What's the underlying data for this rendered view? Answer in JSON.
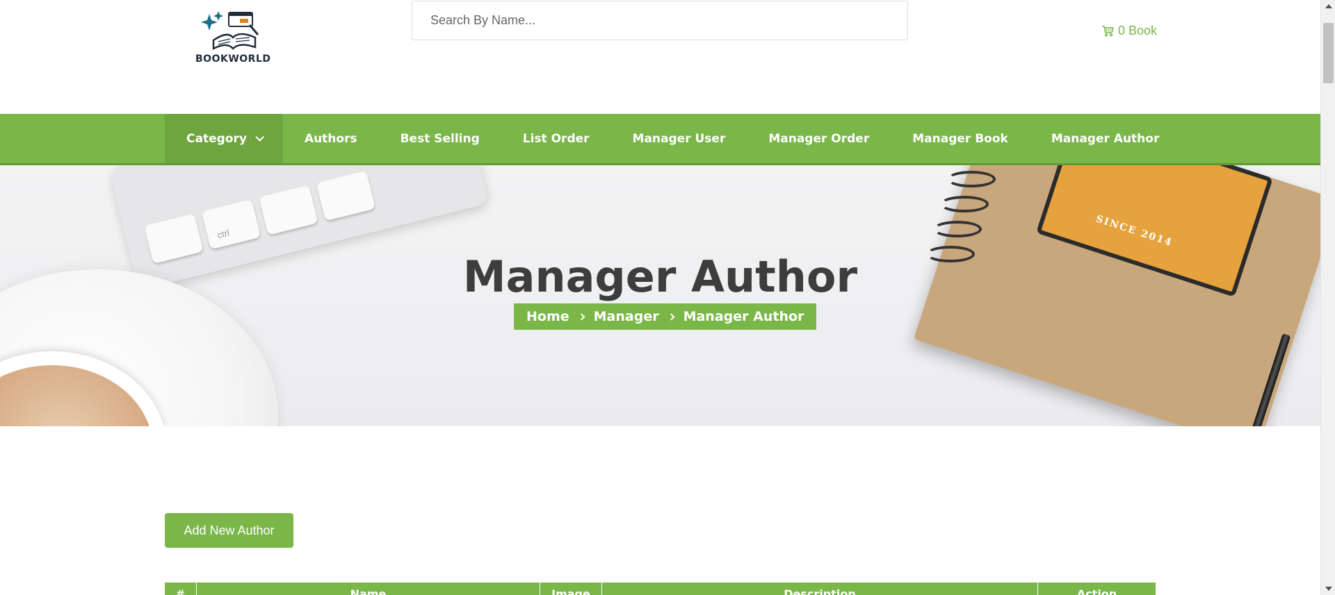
{
  "header": {
    "logo_text": "BOOKWORLD",
    "search_placeholder": "Search By Name...",
    "cart_label": "0 Book"
  },
  "nav": {
    "items": [
      {
        "label": "Category",
        "has_dropdown": true
      },
      {
        "label": "Authors"
      },
      {
        "label": "Best Selling"
      },
      {
        "label": "List Order"
      },
      {
        "label": "Manager User"
      },
      {
        "label": "Manager Order"
      },
      {
        "label": "Manager Book"
      },
      {
        "label": "Manager Author"
      }
    ]
  },
  "hero": {
    "title": "Manager Author",
    "breadcrumb": [
      "Home",
      "Manager",
      "Manager Author"
    ],
    "keyboard_key_label": "ctrl",
    "notebook_text": "SINCE 2014"
  },
  "main": {
    "add_button_label": "Add New Author",
    "table": {
      "headers": [
        "#",
        "Name",
        "Image",
        "Description",
        "Action"
      ]
    }
  },
  "colors": {
    "accent": "#7ab648",
    "nav_active": "#6ea53f",
    "title_text": "#3d3d3d"
  }
}
